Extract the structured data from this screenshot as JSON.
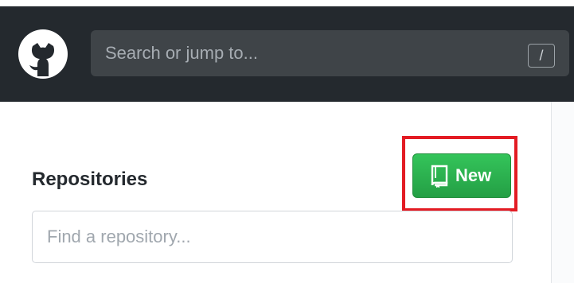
{
  "header": {
    "logo_icon": "github-mark-icon",
    "search": {
      "placeholder": "Search or jump to...",
      "shortcut": "/"
    }
  },
  "repositories": {
    "title": "Repositories",
    "new_button": {
      "icon": "book-icon",
      "label": "New"
    },
    "find_input": {
      "placeholder": "Find a repository..."
    }
  },
  "colors": {
    "header_background": "#24292e",
    "new_button_green": "#2ea44f",
    "highlight_red": "#e31b23"
  }
}
